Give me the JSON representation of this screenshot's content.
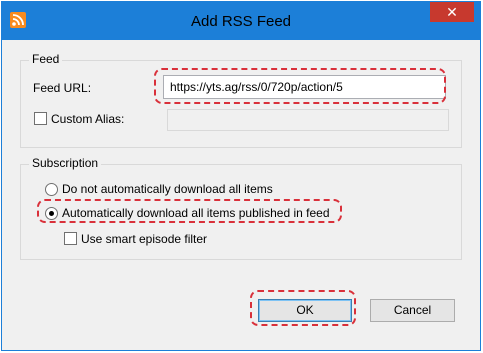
{
  "window": {
    "title": "Add RSS Feed",
    "close_glyph": "✕",
    "icon": "rss-icon"
  },
  "feed_group": {
    "label": "Feed",
    "url_label": "Feed URL:",
    "url_value": "https://yts.ag/rss/0/720p/action/5",
    "alias_label": "Custom Alias:",
    "alias_value": ""
  },
  "subscription_group": {
    "label": "Subscription",
    "option_no_download": "Do not automatically download all items",
    "option_auto_download": "Automatically download all items published in feed",
    "smart_filter_label": "Use smart episode filter",
    "selected_option": "auto_download"
  },
  "buttons": {
    "ok": "OK",
    "cancel": "Cancel"
  },
  "colors": {
    "title_bar": "#1c7fd8",
    "close": "#c7392e",
    "highlight": "#d9303a",
    "rss": "#f78b1f"
  }
}
